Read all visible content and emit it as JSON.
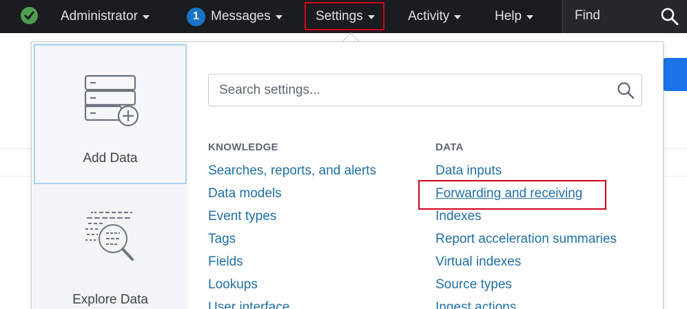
{
  "topbar": {
    "status_icon": "check-circle-icon",
    "admin_label": "Administrator",
    "messages_count": "1",
    "messages_label": "Messages",
    "settings_label": "Settings",
    "activity_label": "Activity",
    "help_label": "Help",
    "find_label": "Find"
  },
  "dropdown": {
    "tiles": [
      {
        "label": "Add Data",
        "icon": "add-data-icon"
      },
      {
        "label": "Explore Data",
        "icon": "explore-data-icon"
      }
    ],
    "search": {
      "placeholder": "Search settings..."
    },
    "knowledge": {
      "heading": "KNOWLEDGE",
      "items": [
        "Searches, reports, and alerts",
        "Data models",
        "Event types",
        "Tags",
        "Fields",
        "Lookups",
        "User interface"
      ]
    },
    "data": {
      "heading": "DATA",
      "items": [
        "Data inputs",
        "Forwarding and receiving",
        "Indexes",
        "Report acceleration summaries",
        "Virtual indexes",
        "Source types",
        "Ingest actions"
      ]
    }
  },
  "colors": {
    "topbar_bg": "#1a1c20",
    "link": "#1f6fa8",
    "highlight_box": "#d0021b",
    "messages_badge": "#1a73c9",
    "status_ok": "#4c9f4f"
  }
}
